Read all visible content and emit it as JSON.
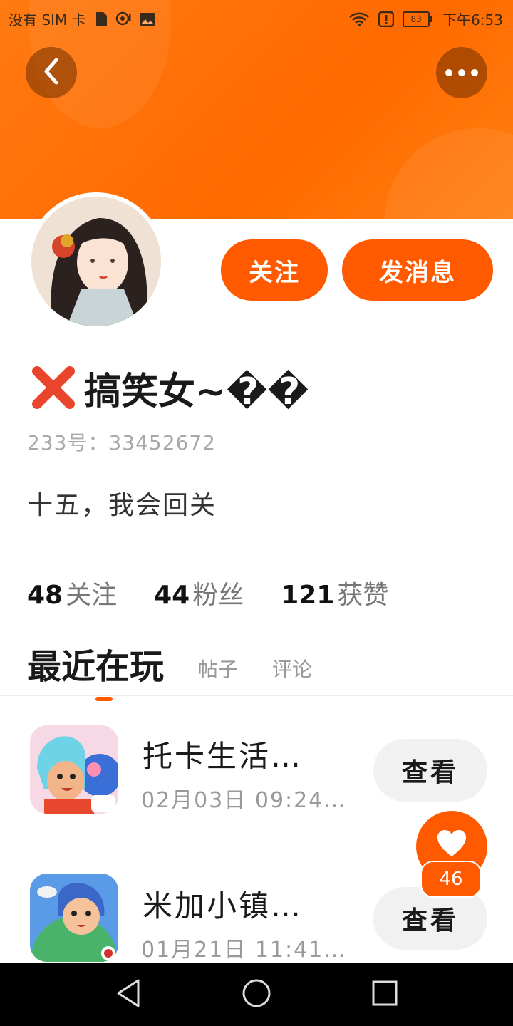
{
  "status_bar": {
    "carrier": "没有 SIM 卡",
    "battery": "83",
    "time": "下午6:53",
    "icons": [
      "sd-card-icon",
      "hotspot-icon",
      "image-icon",
      "wifi-icon",
      "alert-icon",
      "battery-icon"
    ]
  },
  "header": {
    "back_icon": "chevron-left-icon",
    "more_icon": "more-dots-icon",
    "color": "#ff6a00"
  },
  "profile": {
    "name_mark": "❌",
    "name": "搞笑女~��",
    "uid": "233号：33452672",
    "bio": "十五，我会回关",
    "follow_label": "关注",
    "message_label": "发消息",
    "stats": [
      {
        "num": "48",
        "label": "关注"
      },
      {
        "num": "44",
        "label": "粉丝"
      },
      {
        "num": "121",
        "label": "获赞"
      }
    ]
  },
  "tabs": {
    "active": "最近在玩",
    "posts": "帖子",
    "comments": "评论"
  },
  "games": [
    {
      "title": "托卡生活…",
      "time": "02月03日 09:24…",
      "button": "查看"
    },
    {
      "title": "米加小镇…",
      "time": "01月21日 11:41…",
      "button": "查看"
    }
  ],
  "like": {
    "count": "46",
    "icon": "heart-icon"
  },
  "nav": {
    "icons": [
      "back-triangle-icon",
      "home-circle-icon",
      "recents-square-icon"
    ]
  },
  "colors": {
    "accent": "#ff5a00",
    "header": "#ff6a00"
  }
}
